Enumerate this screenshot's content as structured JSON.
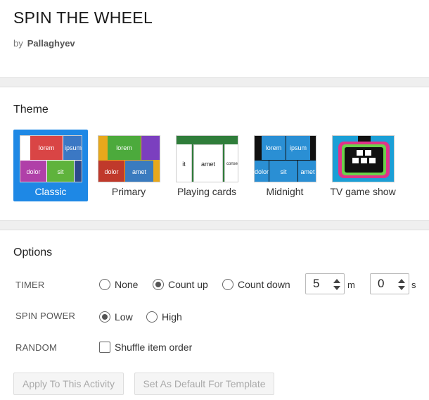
{
  "header": {
    "title": "SPIN THE WHEEL",
    "by": "by",
    "author": "Pallaghyev"
  },
  "theme_section": {
    "title": "Theme",
    "selected": "Classic",
    "items": [
      {
        "label": "Classic",
        "tiles": [
          "lorem",
          "ipsum",
          "dolor",
          "sit"
        ]
      },
      {
        "label": "Primary",
        "tiles": [
          "lorem",
          "dolor",
          "amet"
        ]
      },
      {
        "label": "Playing cards",
        "tiles": [
          "it",
          "amet",
          "conse"
        ]
      },
      {
        "label": "Midnight",
        "tiles": [
          "lorem",
          "ipsum",
          "dolor",
          "sit",
          "amet"
        ]
      },
      {
        "label": "TV game show"
      }
    ]
  },
  "options": {
    "title": "Options",
    "timer": {
      "label": "TIMER",
      "choices": [
        "None",
        "Count up",
        "Count down"
      ],
      "selected": "Count up",
      "minutes": "5",
      "minutes_unit": "m",
      "seconds": "0",
      "seconds_unit": "s"
    },
    "spin_power": {
      "label": "SPIN POWER",
      "choices": [
        "Low",
        "High"
      ],
      "selected": "Low"
    },
    "random": {
      "label": "RANDOM",
      "checkbox_label": "Shuffle item order",
      "checked": false
    }
  },
  "buttons": {
    "apply": "Apply To This Activity",
    "set_default": "Set As Default For Template"
  },
  "colors": {
    "selected_theme": "#1e88e5",
    "band": "#efefef",
    "disabled_text": "#aaaaaa"
  }
}
